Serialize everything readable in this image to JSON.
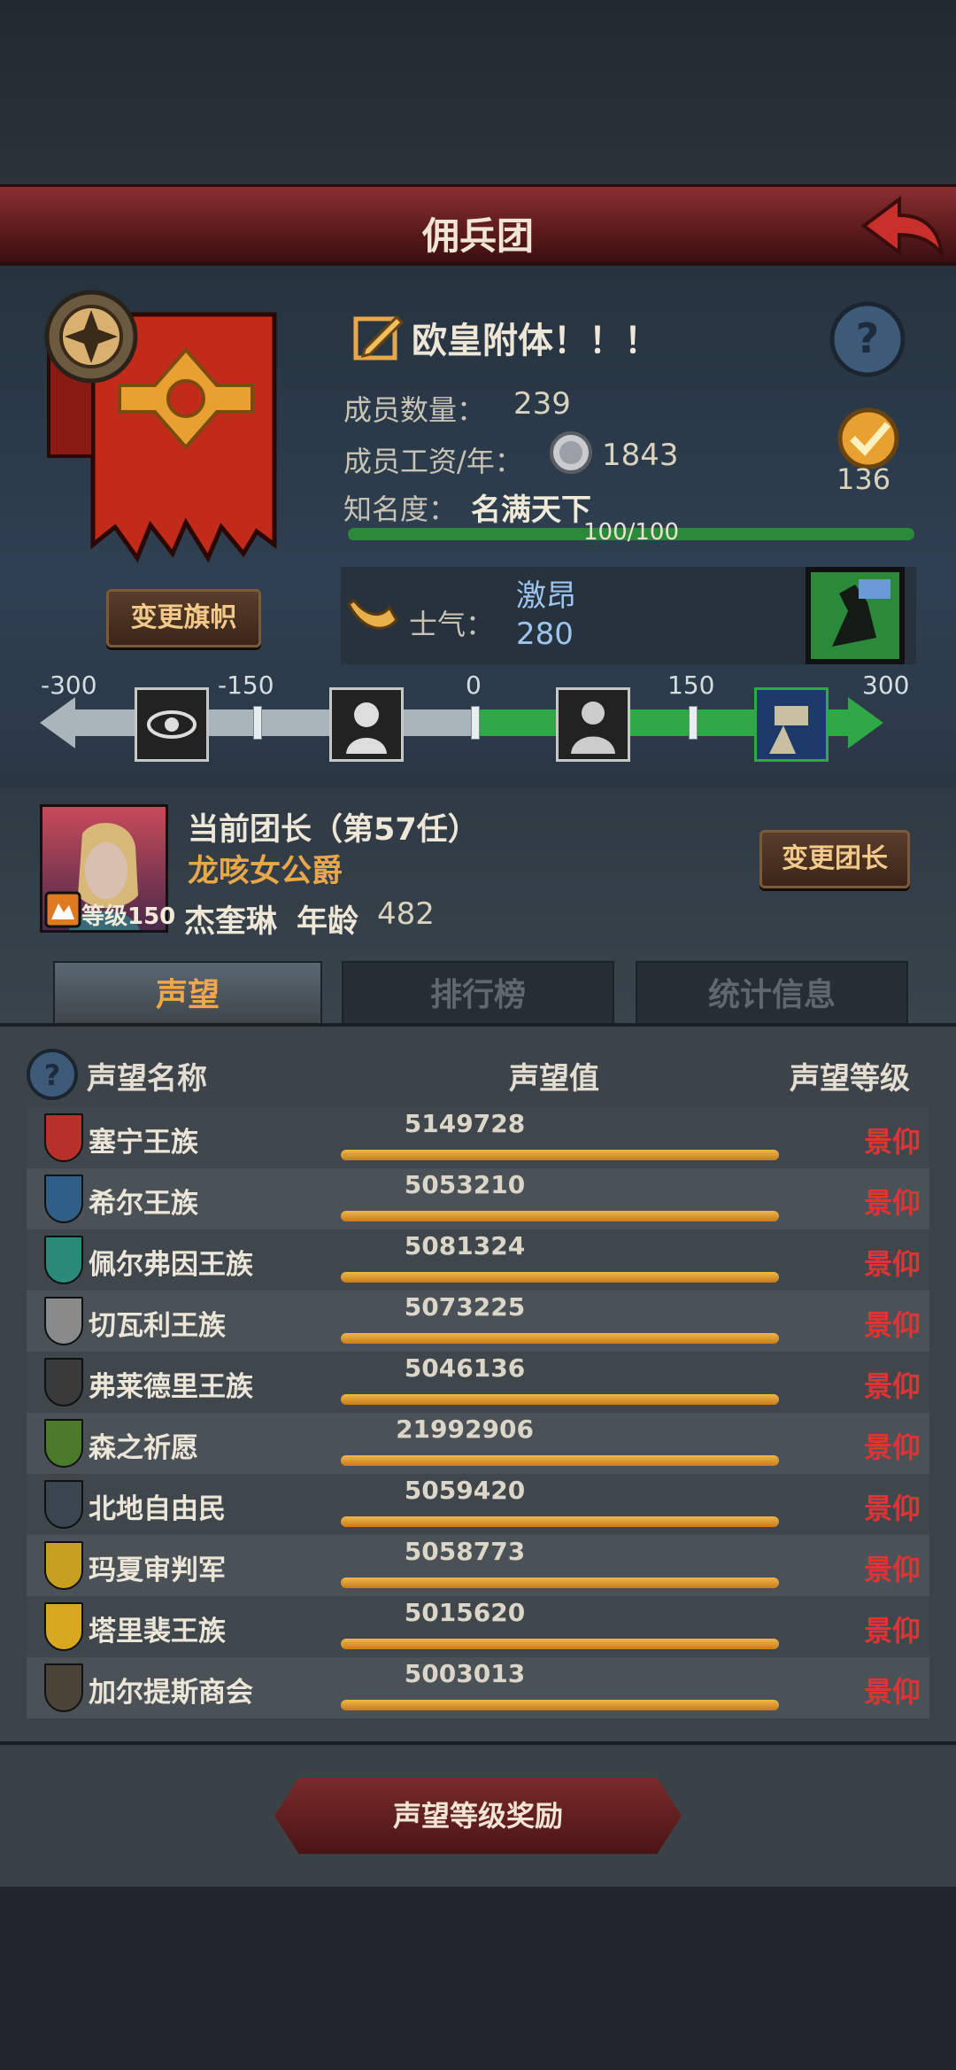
{
  "header": {
    "title": "佣兵团"
  },
  "company": {
    "name": "欧皇附体！！！",
    "members_label": "成员数量：",
    "members": "239",
    "salary_label": "成员工资/年：",
    "salary": "1843",
    "fame_label": "知名度：",
    "fame_value": "名满天下",
    "fame_progress": "100/100",
    "fame_fraction": 1.0,
    "badge_count": "136",
    "change_banner_label": "变更旗帜",
    "morale_label": "士气：",
    "morale_state": "激昂",
    "morale_value": "280"
  },
  "morale_scale": {
    "ticks": [
      "-300",
      "-150",
      "0",
      "150",
      "300"
    ],
    "current": 280
  },
  "leader": {
    "title": "当前团长（第57任）",
    "rank": "龙咳女公爵",
    "name": "杰奎琳",
    "age_label": "年龄",
    "age": "482",
    "level_label": "等级150",
    "change_label": "变更团长"
  },
  "tabs": [
    {
      "label": "声望"
    },
    {
      "label": "排行榜"
    },
    {
      "label": "统计信息"
    }
  ],
  "list": {
    "col_name": "声望名称",
    "col_value": "声望值",
    "col_level": "声望等级",
    "rows": [
      {
        "name": "塞宁王族",
        "value": "5149728",
        "level": "景仰",
        "color": "#b8302a"
      },
      {
        "name": "希尔王族",
        "value": "5053210",
        "level": "景仰",
        "color": "#2f5f86"
      },
      {
        "name": "佩尔弗因王族",
        "value": "5081324",
        "level": "景仰",
        "color": "#2a8a7a"
      },
      {
        "name": "切瓦利王族",
        "value": "5073225",
        "level": "景仰",
        "color": "#8a8a8a"
      },
      {
        "name": "弗莱德里王族",
        "value": "5046136",
        "level": "景仰",
        "color": "#3a3a3a"
      },
      {
        "name": "森之祈愿",
        "value": "21992906",
        "level": "景仰",
        "color": "#4a7a2a"
      },
      {
        "name": "北地自由民",
        "value": "5059420",
        "level": "景仰",
        "color": "#3a4550"
      },
      {
        "name": "玛夏审判军",
        "value": "5058773",
        "level": "景仰",
        "color": "#c8a020"
      },
      {
        "name": "塔里裴王族",
        "value": "5015620",
        "level": "景仰",
        "color": "#d8a820"
      },
      {
        "name": "加尔提斯商会",
        "value": "5003013",
        "level": "景仰",
        "color": "#4a4438"
      }
    ]
  },
  "footer": {
    "reward_label": "声望等级奖励"
  }
}
